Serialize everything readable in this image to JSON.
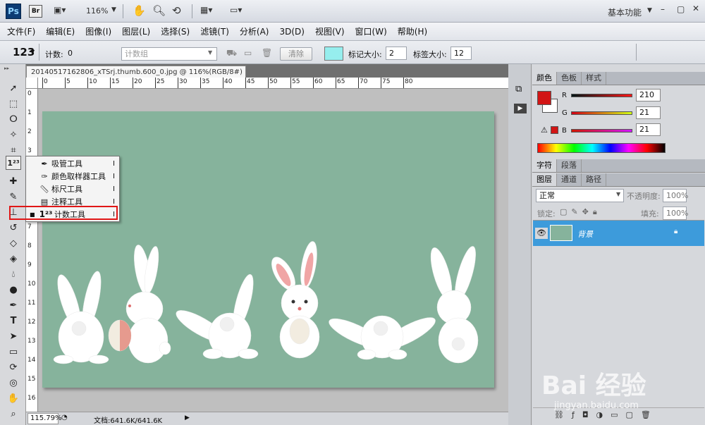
{
  "app": {
    "logo": "Ps",
    "bridge": "Br",
    "zoom": "116%",
    "workspace": "基本功能"
  },
  "menu": [
    "文件(F)",
    "编辑(E)",
    "图像(I)",
    "图层(L)",
    "选择(S)",
    "滤镜(T)",
    "分析(A)",
    "3D(D)",
    "视图(V)",
    "窗口(W)",
    "帮助(H)"
  ],
  "options": {
    "tool_glyph": "123",
    "count_label": "计数:",
    "count_value": "0",
    "group_placeholder": "计数组",
    "clear_label": "清除",
    "marker_size_label": "标记大小:",
    "marker_size_value": "2",
    "label_size_label": "标签大小:",
    "label_size_value": "12",
    "swatch_color": "#96eeee"
  },
  "document": {
    "tab_title": "20140517162806_xTSrj.thumb.600_0.jpg @ 116%(RGB/8#) *",
    "close": "×",
    "ruler_ticks": [
      "0",
      "5",
      "10",
      "15",
      "20",
      "25",
      "30",
      "35",
      "40",
      "45",
      "50",
      "55",
      "60",
      "65",
      "70",
      "75",
      "80"
    ],
    "vruler_ticks": [
      "0",
      "1",
      "2",
      "3",
      "4",
      "5",
      "6",
      "7",
      "8",
      "9",
      "10",
      "11",
      "12",
      "13",
      "14",
      "15",
      "16",
      "17"
    ],
    "canvas_color": "#86b39c"
  },
  "flyout": {
    "items": [
      {
        "label": "吸管工具",
        "key": "I",
        "icon": "eyedropper-icon"
      },
      {
        "label": "颜色取样器工具",
        "key": "I",
        "icon": "color-sampler-icon"
      },
      {
        "label": "标尺工具",
        "key": "I",
        "icon": "ruler-icon"
      },
      {
        "label": "注释工具",
        "key": "I",
        "icon": "note-icon"
      },
      {
        "label": "计数工具",
        "key": "I",
        "icon": "count-icon"
      }
    ],
    "highlight_color": "#e01616"
  },
  "status": {
    "zoom": "115.79%",
    "doc_info": "文档:641.6K/641.6K"
  },
  "color_panel": {
    "tabs": [
      "颜色",
      "色板",
      "样式"
    ],
    "r_label": "R",
    "r_value": "210",
    "g_label": "G",
    "g_value": "21",
    "b_label": "B",
    "b_value": "21",
    "fg_color": "#d21515"
  },
  "char_panel": {
    "tabs": [
      "字符",
      "段落"
    ]
  },
  "layers_panel": {
    "tabs": [
      "图层",
      "通道",
      "路径"
    ],
    "blend_mode": "正常",
    "opacity_label": "不透明度:",
    "opacity_value": "100%",
    "lock_label": "锁定:",
    "fill_label": "填充:",
    "fill_value": "100%",
    "layer_name": "背景",
    "selected_color": "#3d9bdb"
  },
  "watermark": {
    "text": "Bai 经验",
    "url": "jingyan.baidu.com"
  }
}
